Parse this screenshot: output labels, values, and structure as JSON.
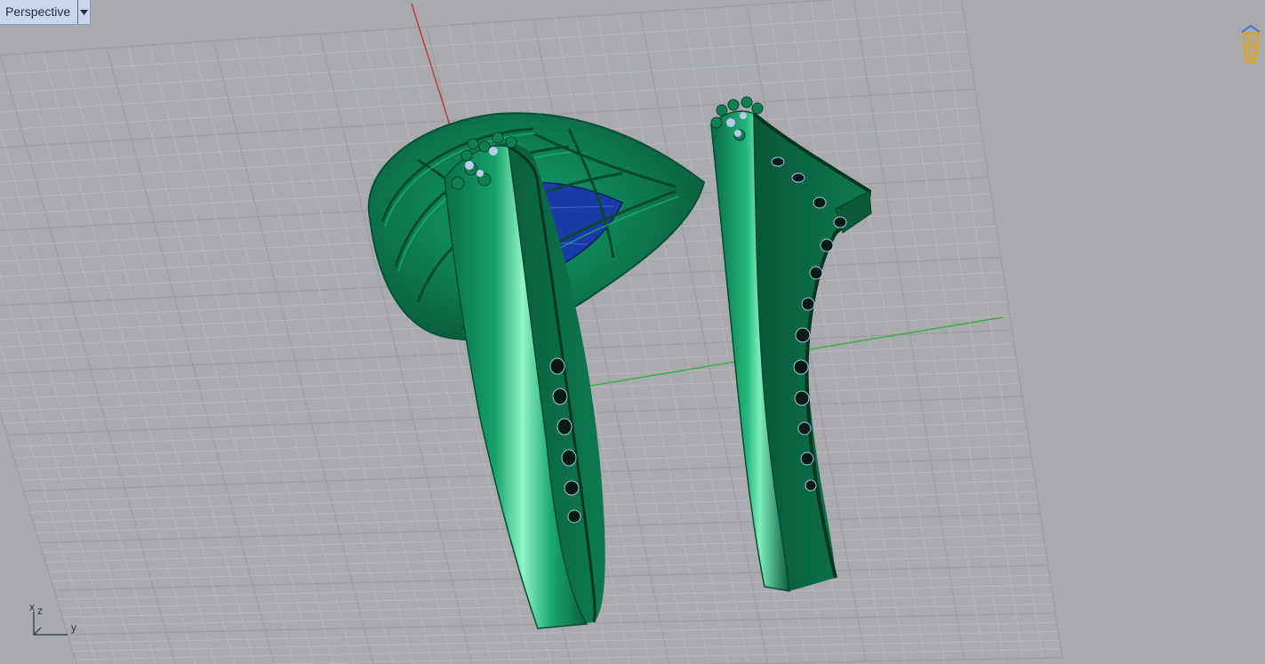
{
  "viewport": {
    "name": "Perspective",
    "menu_icon": "chevron-down-icon"
  },
  "axis_widget": {
    "x": "x",
    "y": "y",
    "z": "z"
  },
  "overlay_icon": "navigation-icon",
  "colors": {
    "background": "#a8aaaf",
    "grid_minor": "#b8babe",
    "grid_major": "#9a9ca1",
    "x_axis": "#c23a3a",
    "y_axis": "#3fae3a",
    "model": "#0f8a58",
    "gem": "#1a3aa6",
    "accent_blue": "#b7cce8"
  }
}
